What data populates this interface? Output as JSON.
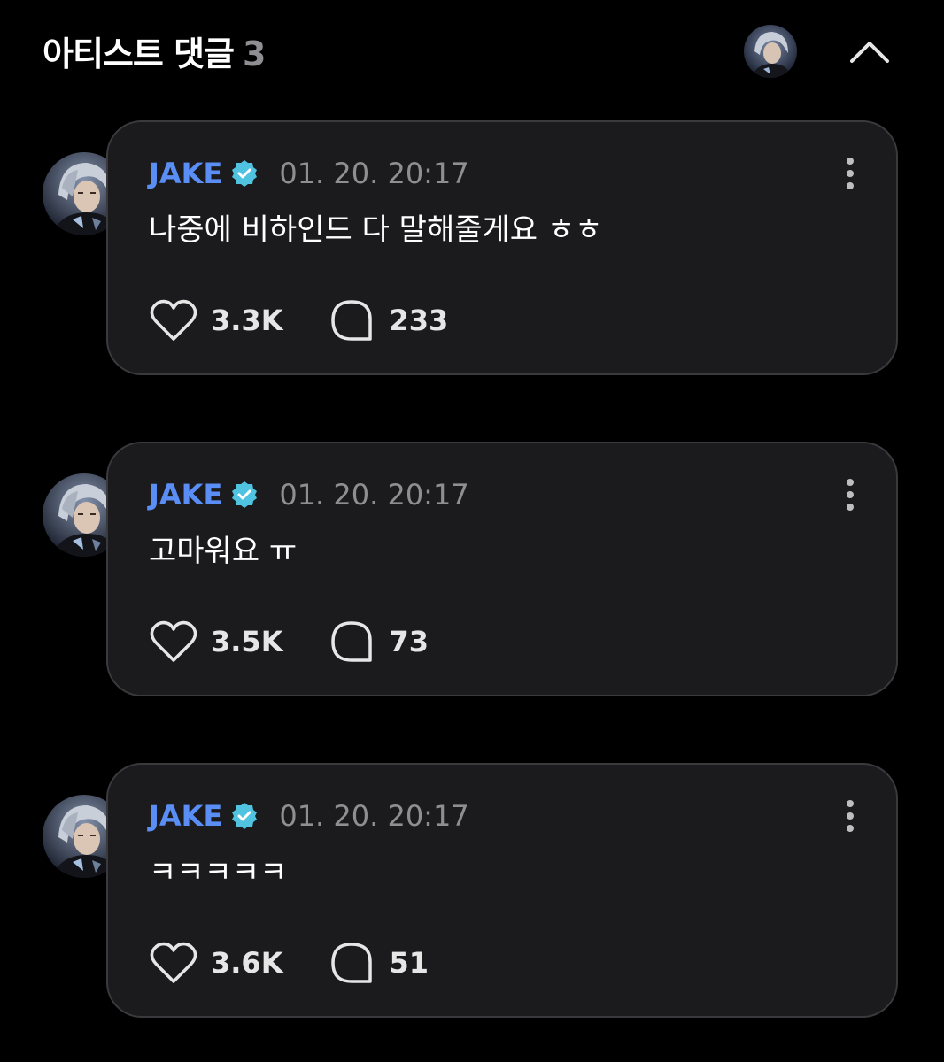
{
  "header": {
    "title": "아티스트 댓글",
    "count": "3"
  },
  "comments": [
    {
      "author": "JAKE",
      "timestamp": "01. 20. 20:17",
      "text": "나중에 비하인드 다 말해줄게요 ㅎㅎ",
      "likes": "3.3K",
      "replies": "233"
    },
    {
      "author": "JAKE",
      "timestamp": "01. 20. 20:17",
      "text": "고마워요 ㅠ",
      "likes": "3.5K",
      "replies": "73"
    },
    {
      "author": "JAKE",
      "timestamp": "01. 20. 20:17",
      "text": "ㅋㅋㅋㅋㅋ",
      "likes": "3.6K",
      "replies": "51"
    }
  ],
  "icons": {
    "verified": "verified-badge-icon",
    "more": "more-vertical-icon",
    "like": "heart-icon",
    "reply": "speech-bubble-icon",
    "collapse": "chevron-up-icon"
  },
  "colors": {
    "background": "#000000",
    "card": "#1b1b1d",
    "card_border": "#3a3a3e",
    "author": "#5b8ef5",
    "verified": "#4fc3e0",
    "muted": "#8e8e93"
  }
}
